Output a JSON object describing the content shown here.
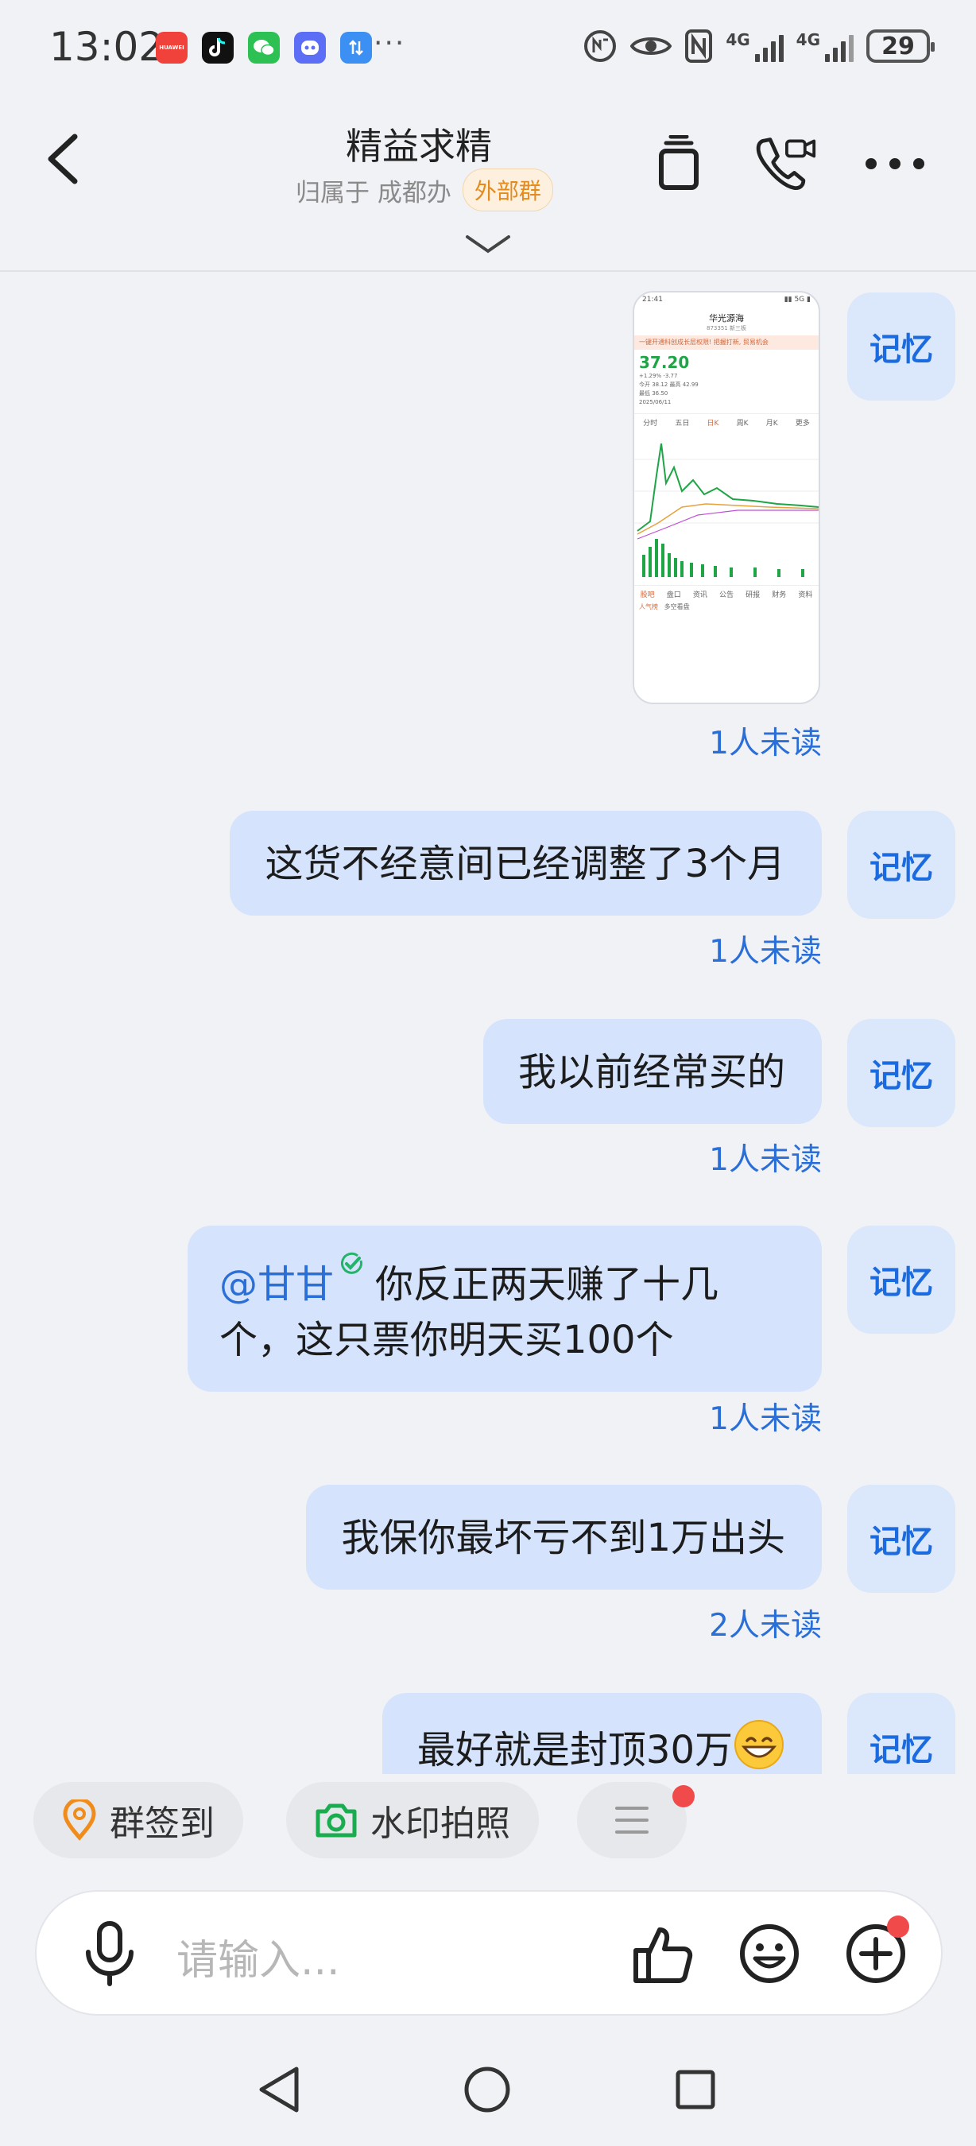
{
  "status_bar": {
    "time": "13:02",
    "app_icons": [
      "huawei-app-icon",
      "tiktok-icon",
      "wechat-icon",
      "bot-icon",
      "transfer-icon"
    ],
    "huawei_label": "HUAWEI",
    "more": "···",
    "network_1": "4G",
    "network_2": "4G",
    "battery": "29"
  },
  "header": {
    "title": "精益求精",
    "subtitle": "归属于 成都办",
    "badge": "外部群"
  },
  "thumbnail": {
    "time": "21:41",
    "stock_name": "华光源海",
    "stock_code": "873351 新三板",
    "banner": "一键开通科创成长层权限! 把握打新, 贸易机会",
    "price": "37.20",
    "change": "+1.29% -3.77",
    "date": "2025/06/11",
    "open": "今开 38.12",
    "high": "最高 42.99",
    "low": "最低 36.50",
    "tabs": [
      "分时",
      "五日",
      "日K",
      "周K",
      "月K",
      "更多"
    ],
    "bottom_tabs": [
      "股吧",
      "盘口",
      "资讯",
      "公告",
      "研报",
      "财务",
      "资料"
    ],
    "bottom_left": "人气榜",
    "bottom_right": "多空看盘"
  },
  "messages": [
    {
      "type": "image",
      "read": "1人未读",
      "avatar": "记忆"
    },
    {
      "type": "text",
      "text": "这货不经意间已经调整了3个月",
      "read": "1人未读",
      "avatar": "记忆"
    },
    {
      "type": "text",
      "text": "我以前经常买的",
      "read": "1人未读",
      "avatar": "记忆"
    },
    {
      "type": "mention",
      "mention": "@甘甘",
      "line1": "你反正两天赚了十几",
      "line2": "个，这只票你明天买100个",
      "read": "1人未读",
      "avatar": "记忆"
    },
    {
      "type": "text",
      "text": "我保你最坏亏不到1万出头",
      "read": "2人未读",
      "avatar": "记忆"
    },
    {
      "type": "text",
      "text": "最好就是封顶30万",
      "emoji": "grinning-face-emoji",
      "avatar": "记忆"
    }
  ],
  "quick_actions": [
    {
      "label": "群签到",
      "icon": "location-pin-icon",
      "color": "#f08c1c"
    },
    {
      "label": "水印拍照",
      "icon": "camera-icon",
      "color": "#1aad4f"
    },
    {
      "label": "",
      "icon": "menu-icon",
      "badge": true
    }
  ],
  "input": {
    "placeholder": "请输入..."
  },
  "colors": {
    "bubble": "#d5e4fc",
    "accent": "#2a6ed8",
    "badge_text": "#e48b1e",
    "stock_up": "#1fa446"
  }
}
